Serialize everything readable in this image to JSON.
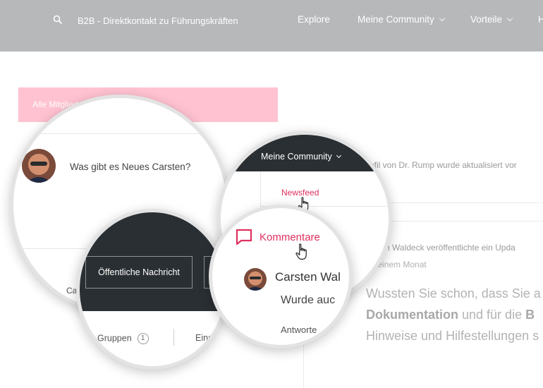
{
  "header": {
    "search_icon": "search-icon",
    "site_title": "B2B - Direktkontakt zu Führungskräften",
    "nav": [
      {
        "label": "Explore",
        "has_dropdown": false
      },
      {
        "label": "Meine Community",
        "has_dropdown": true
      },
      {
        "label": "Vorteile",
        "has_dropdown": true
      },
      {
        "label": "H",
        "has_dropdown": false
      }
    ]
  },
  "filter_bar": {
    "label": "Alle Mitglied"
  },
  "post_box": {
    "prompt": "Was gibt es Neues Carsten?",
    "public_button": "Öffentliche Nachricht",
    "footer_text": "Car"
  },
  "tabs": {
    "groups_label": "Gruppen",
    "groups_count": "1",
    "settings_label": "Einst"
  },
  "menu": {
    "label": "Meine Community",
    "newsfeed": "Newsfeed"
  },
  "comments": {
    "label": "Kommentare",
    "author": "Carsten Wal",
    "text": "Wurde auc",
    "reply": "Antworte"
  },
  "feed": {
    "line1": "rofil von Dr. Rump wurde aktualisiert vor",
    "line2_name": "sten Waldeck",
    "line2_rest": " veröffentlichte ein Upda",
    "time": "r einem Monat",
    "text1": "Wussten Sie schon, dass Sie a",
    "text2_bold1": "Dokumentation",
    "text2_mid": " und für die ",
    "text2_bold2": "B",
    "text3": "Hinweise und Hilfestellungen s"
  },
  "colors": {
    "topbar": "#b7b8ba",
    "accent": "#e0305f",
    "filter_bar": "#ffc2d1",
    "dark_panel": "#2a2f33"
  }
}
